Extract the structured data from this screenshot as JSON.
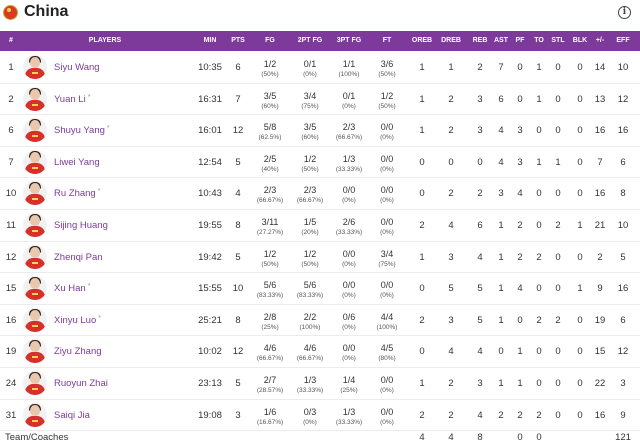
{
  "team": {
    "name": "China",
    "info_icon": "i"
  },
  "columns": {
    "num": "#",
    "players": "PLAYERS",
    "min": "MIN",
    "pts": "PTS",
    "fg": "FG",
    "pt2": "2PT FG",
    "pt3": "3PT FG",
    "ft": "FT",
    "oreb": "OREB",
    "dreb": "DREB",
    "reb": "REB",
    "ast": "AST",
    "pf": "PF",
    "to": "TO",
    "stl": "STL",
    "blk": "BLK",
    "pm": "+/-",
    "eff": "EFF"
  },
  "players": [
    {
      "num": "1",
      "name": "Siyu Wang",
      "starter": "",
      "min": "10:35",
      "pts": "6",
      "fg": "1/2",
      "fg_pct": "(50%)",
      "pt2": "0/1",
      "pt2_pct": "(0%)",
      "pt3": "1/1",
      "pt3_pct": "(100%)",
      "ft": "3/6",
      "ft_pct": "(50%)",
      "oreb": "1",
      "dreb": "1",
      "reb": "2",
      "ast": "7",
      "pf": "0",
      "to": "1",
      "stl": "0",
      "blk": "0",
      "pm": "14",
      "eff": "10"
    },
    {
      "num": "2",
      "name": "Yuan Li",
      "starter": "*",
      "min": "16:31",
      "pts": "7",
      "fg": "3/5",
      "fg_pct": "(60%)",
      "pt2": "3/4",
      "pt2_pct": "(75%)",
      "pt3": "0/1",
      "pt3_pct": "(0%)",
      "ft": "1/2",
      "ft_pct": "(50%)",
      "oreb": "1",
      "dreb": "2",
      "reb": "3",
      "ast": "6",
      "pf": "0",
      "to": "1",
      "stl": "0",
      "blk": "0",
      "pm": "13",
      "eff": "12"
    },
    {
      "num": "6",
      "name": "Shuyu Yang",
      "starter": "*",
      "min": "16:01",
      "pts": "12",
      "fg": "5/8",
      "fg_pct": "(62.5%)",
      "pt2": "3/5",
      "pt2_pct": "(60%)",
      "pt3": "2/3",
      "pt3_pct": "(66.67%)",
      "ft": "0/0",
      "ft_pct": "(0%)",
      "oreb": "1",
      "dreb": "2",
      "reb": "3",
      "ast": "4",
      "pf": "3",
      "to": "0",
      "stl": "0",
      "blk": "0",
      "pm": "16",
      "eff": "16"
    },
    {
      "num": "7",
      "name": "Liwei Yang",
      "starter": "",
      "min": "12:54",
      "pts": "5",
      "fg": "2/5",
      "fg_pct": "(40%)",
      "pt2": "1/2",
      "pt2_pct": "(50%)",
      "pt3": "1/3",
      "pt3_pct": "(33.33%)",
      "ft": "0/0",
      "ft_pct": "(0%)",
      "oreb": "0",
      "dreb": "0",
      "reb": "0",
      "ast": "4",
      "pf": "3",
      "to": "1",
      "stl": "1",
      "blk": "0",
      "pm": "7",
      "eff": "6"
    },
    {
      "num": "10",
      "name": "Ru Zhang",
      "starter": "*",
      "min": "10:43",
      "pts": "4",
      "fg": "2/3",
      "fg_pct": "(66.67%)",
      "pt2": "2/3",
      "pt2_pct": "(66.67%)",
      "pt3": "0/0",
      "pt3_pct": "(0%)",
      "ft": "0/0",
      "ft_pct": "(0%)",
      "oreb": "0",
      "dreb": "2",
      "reb": "2",
      "ast": "3",
      "pf": "4",
      "to": "0",
      "stl": "0",
      "blk": "0",
      "pm": "16",
      "eff": "8"
    },
    {
      "num": "11",
      "name": "Sijing Huang",
      "starter": "",
      "min": "19:55",
      "pts": "8",
      "fg": "3/11",
      "fg_pct": "(27.27%)",
      "pt2": "1/5",
      "pt2_pct": "(20%)",
      "pt3": "2/6",
      "pt3_pct": "(33.33%)",
      "ft": "0/0",
      "ft_pct": "(0%)",
      "oreb": "2",
      "dreb": "4",
      "reb": "6",
      "ast": "1",
      "pf": "2",
      "to": "0",
      "stl": "2",
      "blk": "1",
      "pm": "21",
      "eff": "10"
    },
    {
      "num": "12",
      "name": "Zhenqi Pan",
      "starter": "",
      "min": "19:42",
      "pts": "5",
      "fg": "1/2",
      "fg_pct": "(50%)",
      "pt2": "1/2",
      "pt2_pct": "(50%)",
      "pt3": "0/0",
      "pt3_pct": "(0%)",
      "ft": "3/4",
      "ft_pct": "(75%)",
      "oreb": "1",
      "dreb": "3",
      "reb": "4",
      "ast": "1",
      "pf": "2",
      "to": "2",
      "stl": "0",
      "blk": "0",
      "pm": "2",
      "eff": "5"
    },
    {
      "num": "15",
      "name": "Xu Han",
      "starter": "*",
      "min": "15:55",
      "pts": "10",
      "fg": "5/6",
      "fg_pct": "(83.33%)",
      "pt2": "5/6",
      "pt2_pct": "(83.33%)",
      "pt3": "0/0",
      "pt3_pct": "(0%)",
      "ft": "0/0",
      "ft_pct": "(0%)",
      "oreb": "0",
      "dreb": "5",
      "reb": "5",
      "ast": "1",
      "pf": "4",
      "to": "0",
      "stl": "0",
      "blk": "1",
      "pm": "9",
      "eff": "16"
    },
    {
      "num": "16",
      "name": "Xinyu Luo",
      "starter": "*",
      "min": "25:21",
      "pts": "8",
      "fg": "2/8",
      "fg_pct": "(25%)",
      "pt2": "2/2",
      "pt2_pct": "(100%)",
      "pt3": "0/6",
      "pt3_pct": "(0%)",
      "ft": "4/4",
      "ft_pct": "(100%)",
      "oreb": "2",
      "dreb": "3",
      "reb": "5",
      "ast": "1",
      "pf": "0",
      "to": "2",
      "stl": "2",
      "blk": "0",
      "pm": "19",
      "eff": "6"
    },
    {
      "num": "19",
      "name": "Ziyu Zhang",
      "starter": "",
      "min": "10:02",
      "pts": "12",
      "fg": "4/6",
      "fg_pct": "(66.67%)",
      "pt2": "4/6",
      "pt2_pct": "(66.67%)",
      "pt3": "0/0",
      "pt3_pct": "(0%)",
      "ft": "4/5",
      "ft_pct": "(80%)",
      "oreb": "0",
      "dreb": "4",
      "reb": "4",
      "ast": "0",
      "pf": "1",
      "to": "0",
      "stl": "0",
      "blk": "0",
      "pm": "15",
      "eff": "12"
    },
    {
      "num": "24",
      "name": "Ruoyun Zhai",
      "starter": "",
      "min": "23:13",
      "pts": "5",
      "fg": "2/7",
      "fg_pct": "(28.57%)",
      "pt2": "1/3",
      "pt2_pct": "(33.33%)",
      "pt3": "1/4",
      "pt3_pct": "(25%)",
      "ft": "0/0",
      "ft_pct": "(0%)",
      "oreb": "1",
      "dreb": "2",
      "reb": "3",
      "ast": "1",
      "pf": "1",
      "to": "0",
      "stl": "0",
      "blk": "0",
      "pm": "22",
      "eff": "3"
    },
    {
      "num": "31",
      "name": "Saiqi Jia",
      "starter": "",
      "min": "19:08",
      "pts": "3",
      "fg": "1/6",
      "fg_pct": "(16.67%)",
      "pt2": "0/3",
      "pt2_pct": "(0%)",
      "pt3": "1/3",
      "pt3_pct": "(33.33%)",
      "ft": "0/0",
      "ft_pct": "(0%)",
      "oreb": "2",
      "dreb": "2",
      "reb": "4",
      "ast": "2",
      "pf": "2",
      "to": "2",
      "stl": "0",
      "blk": "0",
      "pm": "16",
      "eff": "9"
    }
  ],
  "totals": {
    "label": "Team/Coaches",
    "oreb": "4",
    "dreb": "4",
    "reb": "8",
    "pf": "0",
    "to": "0",
    "pm": "121"
  },
  "colors": {
    "header_bg": "#7e3a9a",
    "player_link": "#7e3a9a"
  }
}
